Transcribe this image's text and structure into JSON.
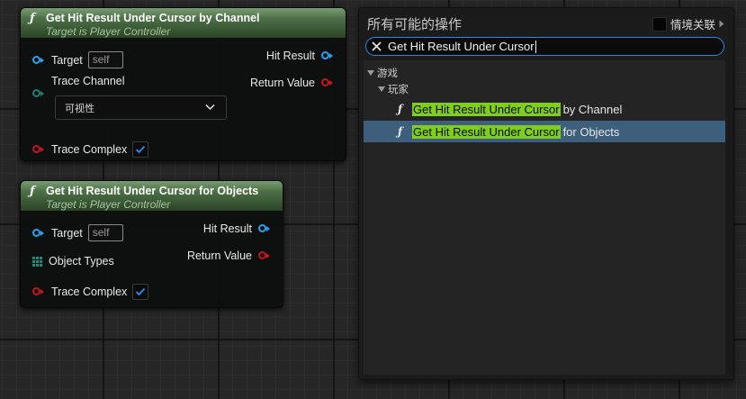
{
  "nodes": [
    {
      "title": "Get Hit Result Under Cursor by Channel",
      "subtitle": "Target is Player Controller",
      "target_label": "Target",
      "target_value": "self",
      "trace_channel_label": "Trace Channel",
      "trace_channel_value": "可视性",
      "trace_complex_label": "Trace Complex",
      "trace_complex_checked": true,
      "hit_result_label": "Hit Result",
      "return_value_label": "Return Value"
    },
    {
      "title": "Get Hit Result Under Cursor for Objects",
      "subtitle": "Target is Player Controller",
      "target_label": "Target",
      "target_value": "self",
      "object_types_label": "Object Types",
      "trace_complex_label": "Trace Complex",
      "trace_complex_checked": true,
      "hit_result_label": "Hit Result",
      "return_value_label": "Return Value"
    }
  ],
  "menu": {
    "title": "所有可能的操作",
    "context_sensitive_label": "情境关联",
    "context_sensitive_checked": false,
    "search_value": "Get Hit Result Under Cursor",
    "category": "游戏",
    "subcategory": "玩家",
    "results": [
      {
        "highlight": "Get Hit Result Under Cursor",
        "rest": "by Channel",
        "selected": false
      },
      {
        "highlight": "Get Hit Result Under Cursor",
        "rest": "for Objects",
        "selected": true
      }
    ]
  },
  "colors": {
    "pin_object": "#2aa0f0",
    "pin_struct": "#c4161e",
    "pin_enum": "#1c7e6c",
    "search_highlight": "#7fcd1f",
    "selection": "#3e5f7c",
    "focus_border": "#2e86e8"
  }
}
